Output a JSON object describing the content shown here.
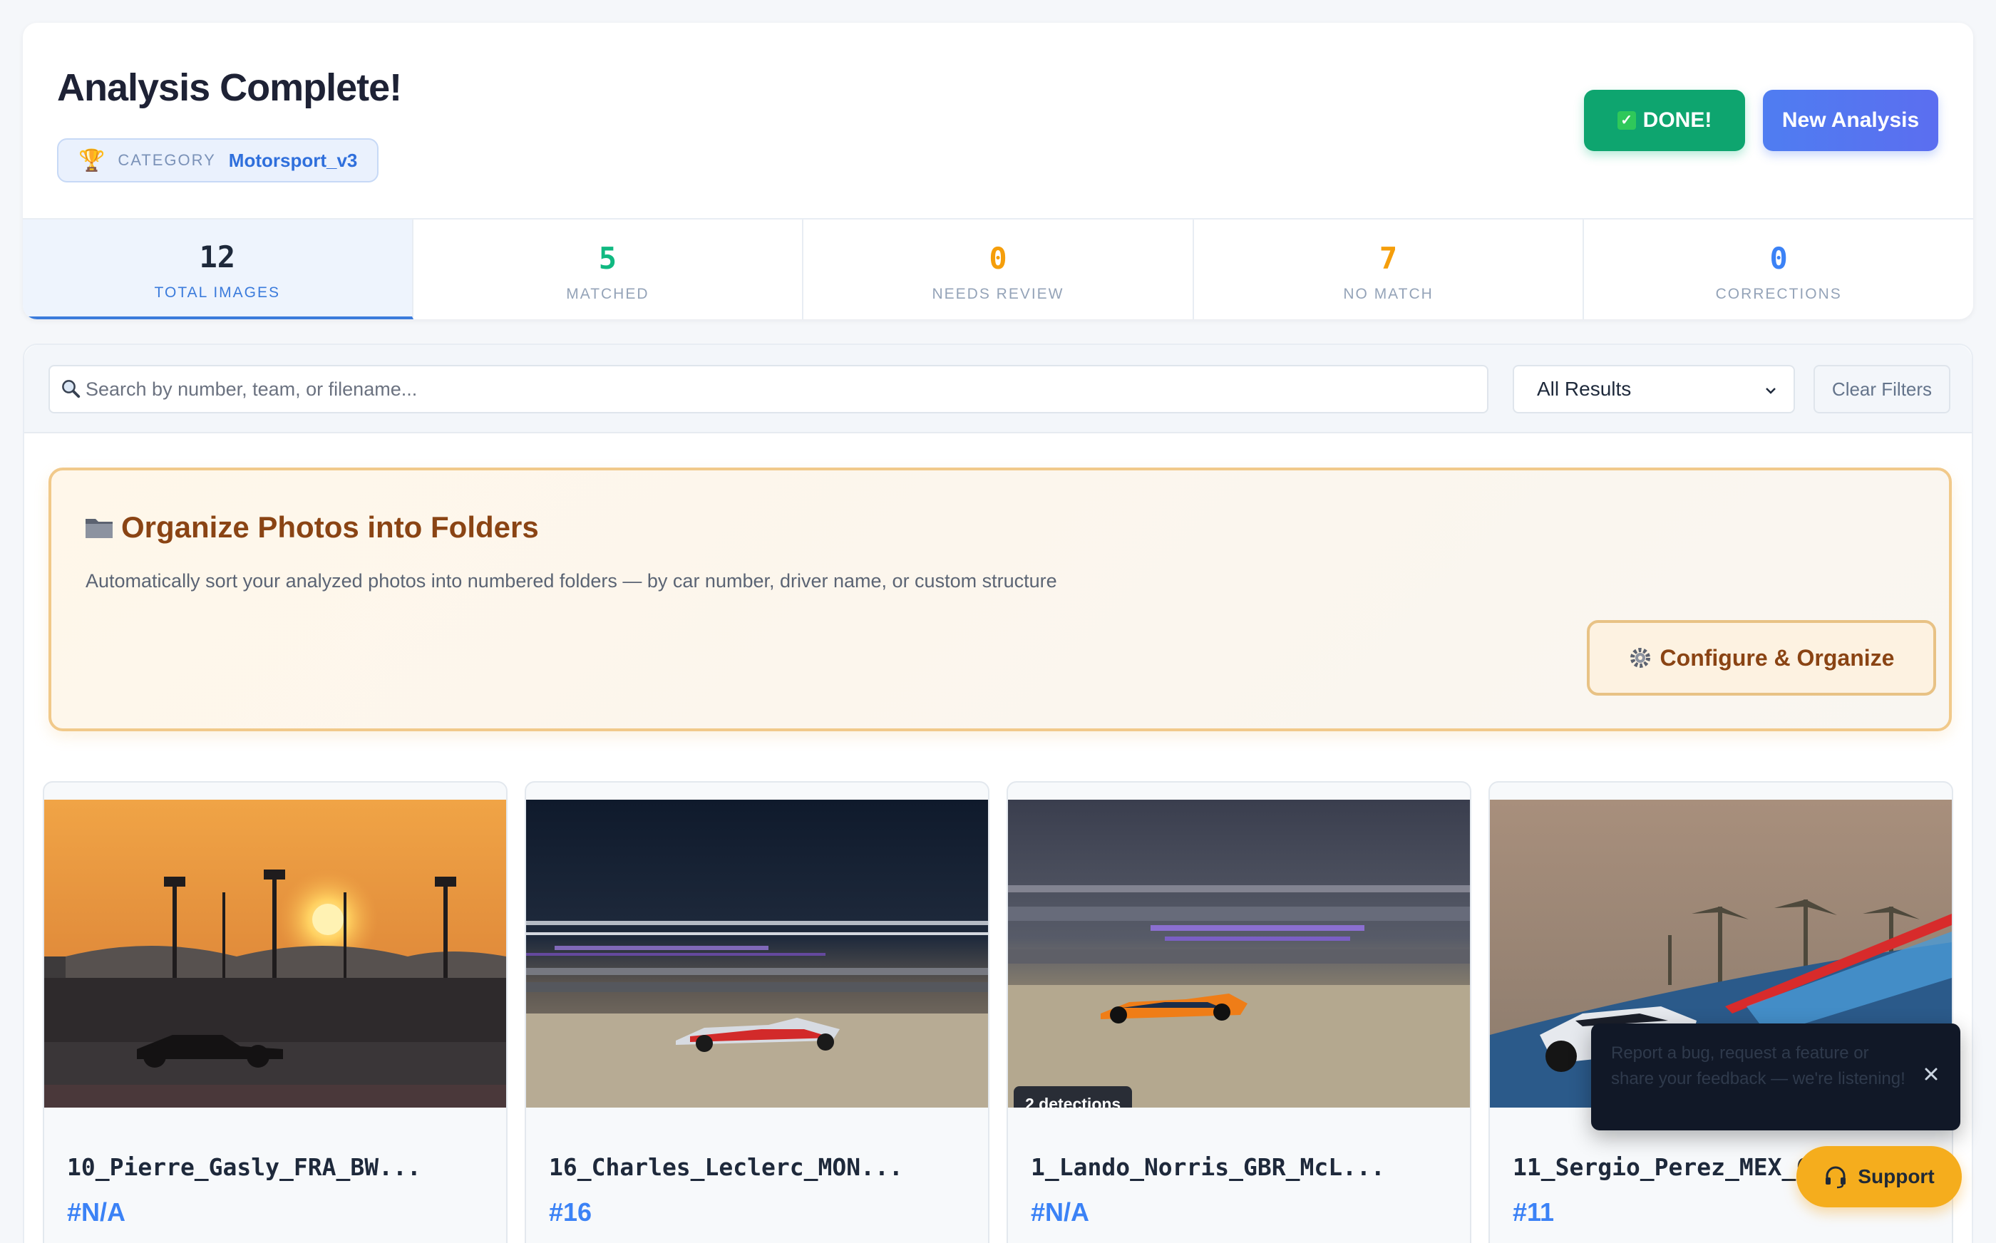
{
  "header": {
    "title": "Analysis Complete!",
    "category_label": "CATEGORY",
    "category_value": "Motorsport_v3",
    "done_label": "DONE!",
    "new_analysis_label": "New Analysis"
  },
  "stats": [
    {
      "value": "12",
      "label": "TOTAL IMAGES",
      "color": "#1e293b"
    },
    {
      "value": "5",
      "label": "MATCHED",
      "color": "#10b981"
    },
    {
      "value": "0",
      "label": "NEEDS REVIEW",
      "color": "#f59e0b"
    },
    {
      "value": "7",
      "label": "NO MATCH",
      "color": "#f59e0b"
    },
    {
      "value": "0",
      "label": "CORRECTIONS",
      "color": "#3b82f6"
    }
  ],
  "filters": {
    "search_placeholder": "Search by number, team, or filename...",
    "result_filter": "All Results",
    "clear_label": "Clear Filters"
  },
  "organize": {
    "title": "Organize Photos into Folders",
    "description": "Automatically sort your analyzed photos into numbered folders — by car number, driver name, or custom structure",
    "button_label": "Configure & Organize"
  },
  "results": [
    {
      "filename": "10_Pierre_Gasly_FRA_BW...",
      "number": "#N/A",
      "detections": ""
    },
    {
      "filename": "16_Charles_Leclerc_MON...",
      "number": "#16",
      "detections": ""
    },
    {
      "filename": "1_Lando_Norris_GBR_McL...",
      "number": "#N/A",
      "detections": "2 detections"
    },
    {
      "filename": "11_Sergio_Perez_MEX_C",
      "number": "#11",
      "detections": ""
    }
  ],
  "feedback": {
    "tooltip_text": "Report a bug, request a feature or share your feedback — we're listening!",
    "support_label": "Support"
  }
}
